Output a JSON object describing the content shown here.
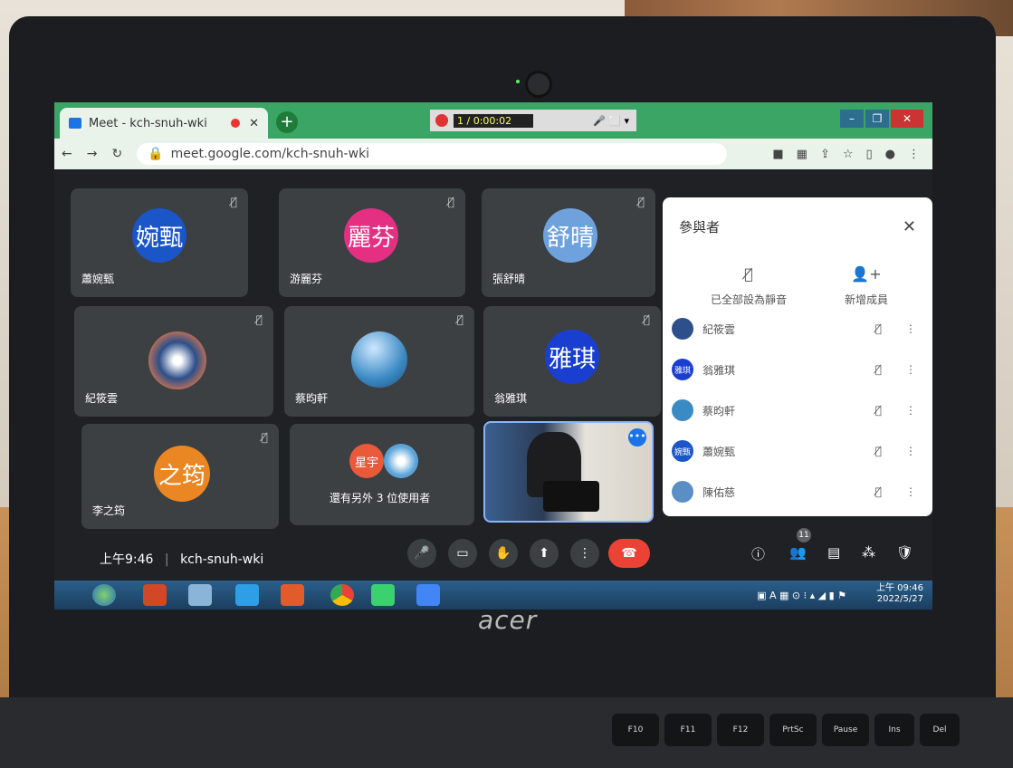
{
  "browser": {
    "tab_title": "Meet - kch-snuh-wki",
    "new_tab": "+",
    "recorder_time": "1 / 0:00:02",
    "url": "meet.google.com/kch-snuh-wki"
  },
  "tiles": [
    {
      "initials": "婉甄",
      "name": "蕭婉甄",
      "color": "#1a56c8"
    },
    {
      "initials": "麗芬",
      "name": "游麗芬",
      "color": "#e52f83"
    },
    {
      "initials": "舒晴",
      "name": "張舒晴",
      "color": "#6fa2dc"
    },
    {
      "initials": "",
      "name": "紀筱雲",
      "color": "#2d4f8a"
    },
    {
      "initials": "",
      "name": "蔡昀軒",
      "color": "#3a8ac4"
    },
    {
      "initials": "雅琪",
      "name": "翁雅琪",
      "color": "#1a3fd0"
    },
    {
      "initials": "之筠",
      "name": "李之筠",
      "color": "#ea8722"
    },
    {
      "initials": "星宇",
      "name": "還有另外 3 位使用者",
      "color": "#e85a3a"
    }
  ],
  "panel": {
    "title": "參與者",
    "mute_all": "已全部設為靜音",
    "add": "新增成員",
    "rows": [
      {
        "name": "紀筱雲",
        "initials": "",
        "color": "#2d4f8a"
      },
      {
        "name": "翁雅琪",
        "initials": "雅琪",
        "color": "#1a3fd0"
      },
      {
        "name": "蔡昀軒",
        "initials": "",
        "color": "#3a8ac4"
      },
      {
        "name": "蕭婉甄",
        "initials": "婉甄",
        "color": "#1a56c8"
      },
      {
        "name": "陳佑慈",
        "initials": "",
        "color": "#5a8ec4"
      }
    ]
  },
  "bottom": {
    "time": "上午9:46",
    "code": "kch-snuh-wki",
    "participants_count": "11"
  },
  "taskbar": {
    "clock_time": "上午 09:46",
    "clock_date": "2022/5/27"
  },
  "laptop_brand": "acer",
  "keys": [
    "F10",
    "F11",
    "F12",
    "PrtSc",
    "Pause",
    "Ins",
    "Del"
  ]
}
